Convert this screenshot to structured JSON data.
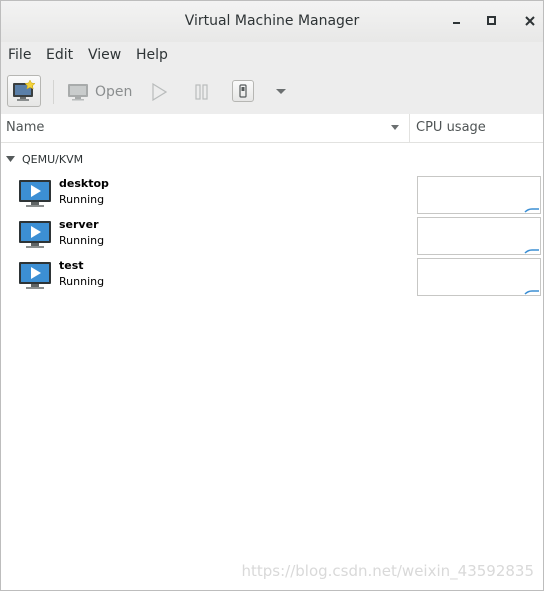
{
  "window": {
    "title": "Virtual Machine Manager"
  },
  "menubar": {
    "items": [
      "File",
      "Edit",
      "View",
      "Help"
    ]
  },
  "toolbar": {
    "new_icon": "new-vm-icon",
    "open_label": "Open",
    "run_icon": "play-icon",
    "pause_icon": "pause-icon",
    "shutdown_icon": "shutdown-icon",
    "menu_icon": "dropdown-arrow-icon"
  },
  "columns": {
    "name": "Name",
    "cpu": "CPU usage"
  },
  "group": {
    "label": "QEMU/KVM"
  },
  "vms": [
    {
      "name": "desktop",
      "status": "Running"
    },
    {
      "name": "server",
      "status": "Running"
    },
    {
      "name": "test",
      "status": "Running"
    }
  ],
  "colors": {
    "accent": "#3c8fd4",
    "window_bg": "#ffffff",
    "toolbar_bg": "#ededed"
  },
  "watermark": "https://blog.csdn.net/weixin_43592835"
}
